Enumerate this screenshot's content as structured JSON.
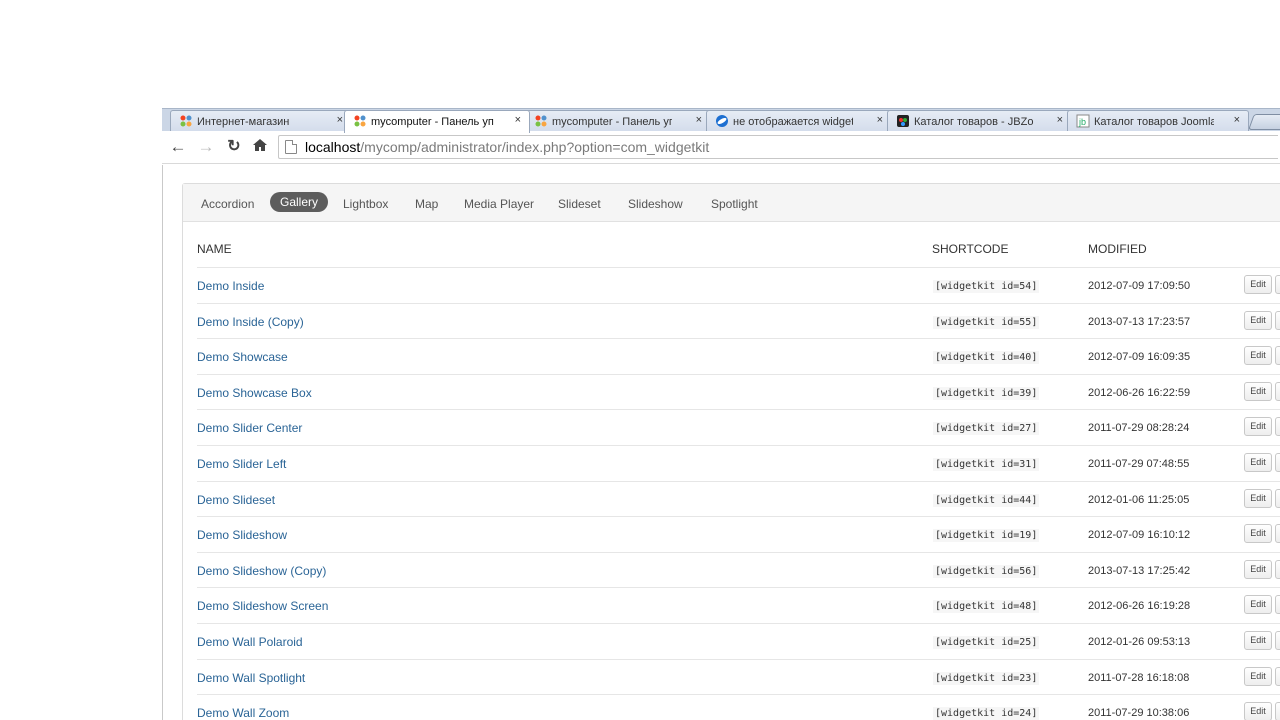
{
  "browser": {
    "tabs": [
      {
        "title": "Интернет-магазин",
        "icon": "joomla-icon",
        "active": false
      },
      {
        "title": "mycomputer - Панель уп",
        "icon": "joomla-icon",
        "active": true
      },
      {
        "title": "mycomputer - Панель уп",
        "icon": "joomla-icon",
        "active": false
      },
      {
        "title": "не отображается widgetk",
        "icon": "forum-icon",
        "active": false
      },
      {
        "title": "Каталог товаров - JBZoo",
        "icon": "jbzoo-icon",
        "active": false
      },
      {
        "title": "Каталог товаров Joomla",
        "icon": "jb-icon",
        "active": false
      }
    ],
    "close_glyph": "×",
    "url_host": "localhost",
    "url_path": "/mycomp/administrator/index.php?option=com_widgetkit"
  },
  "subnav": {
    "items": [
      "Accordion",
      "Gallery",
      "Lightbox",
      "Map",
      "Media Player",
      "Slideset",
      "Slideshow",
      "Spotlight"
    ],
    "active": "Gallery"
  },
  "table": {
    "headers": {
      "name": "NAME",
      "shortcode": "SHORTCODE",
      "modified": "MODIFIED"
    },
    "edit_label": "Edit",
    "rows": [
      {
        "name": "Demo Inside",
        "shortcode": "[widgetkit id=54]",
        "modified": "2012-07-09 17:09:50"
      },
      {
        "name": "Demo Inside (Copy)",
        "shortcode": "[widgetkit id=55]",
        "modified": "2013-07-13 17:23:57"
      },
      {
        "name": "Demo Showcase",
        "shortcode": "[widgetkit id=40]",
        "modified": "2012-07-09 16:09:35"
      },
      {
        "name": "Demo Showcase Box",
        "shortcode": "[widgetkit id=39]",
        "modified": "2012-06-26 16:22:59"
      },
      {
        "name": "Demo Slider Center",
        "shortcode": "[widgetkit id=27]",
        "modified": "2011-07-29 08:28:24"
      },
      {
        "name": "Demo Slider Left",
        "shortcode": "[widgetkit id=31]",
        "modified": "2011-07-29 07:48:55"
      },
      {
        "name": "Demo Slideset",
        "shortcode": "[widgetkit id=44]",
        "modified": "2012-01-06 11:25:05"
      },
      {
        "name": "Demo Slideshow",
        "shortcode": "[widgetkit id=19]",
        "modified": "2012-07-09 16:10:12"
      },
      {
        "name": "Demo Slideshow (Copy)",
        "shortcode": "[widgetkit id=56]",
        "modified": "2013-07-13 17:25:42"
      },
      {
        "name": "Demo Slideshow Screen",
        "shortcode": "[widgetkit id=48]",
        "modified": "2012-06-26 16:19:28"
      },
      {
        "name": "Demo Wall Polaroid",
        "shortcode": "[widgetkit id=25]",
        "modified": "2012-01-26 09:53:13"
      },
      {
        "name": "Demo Wall Spotlight",
        "shortcode": "[widgetkit id=23]",
        "modified": "2011-07-28 16:18:08"
      },
      {
        "name": "Demo Wall Zoom",
        "shortcode": "[widgetkit id=24]",
        "modified": "2011-07-29 10:38:06"
      }
    ]
  },
  "colors": {
    "link": "#2a6496",
    "active_pill": "#5d5d5d"
  }
}
